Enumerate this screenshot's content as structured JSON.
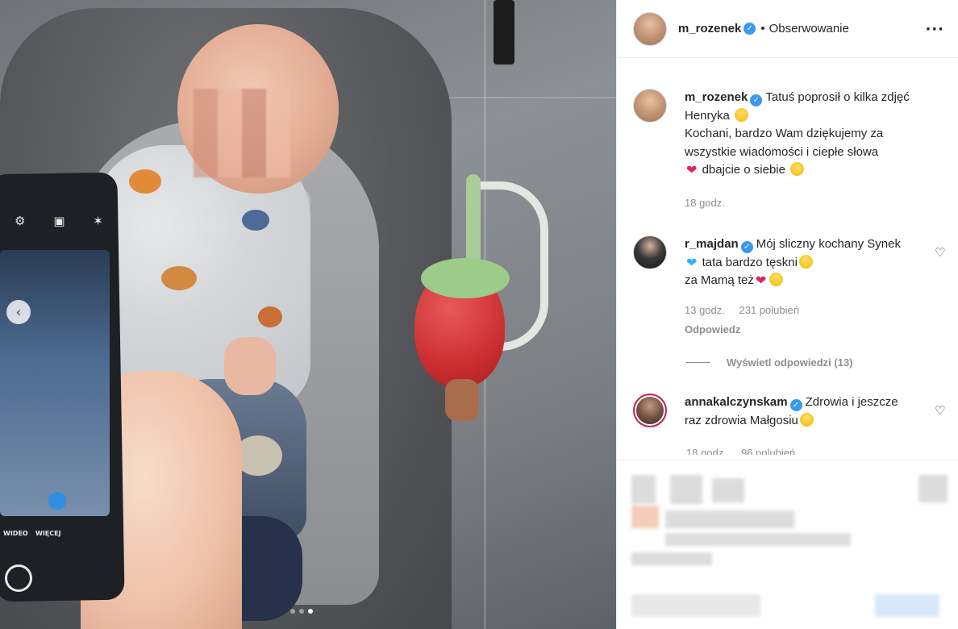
{
  "post": {
    "carousel": {
      "total": 3,
      "current": 3
    },
    "prev_icon": "chevron-left-icon"
  },
  "phone": {
    "mode_video": "WIDEO",
    "mode_more": "WIĘCEJ"
  },
  "header": {
    "username": "m_rozenek",
    "verified_icon": "verified-badge-icon",
    "separator": "•",
    "follow_label": "Obserwowanie",
    "more_icon": "more-horizontal-icon"
  },
  "caption": {
    "username": "m_rozenek",
    "line1": "Tatuś poprosił o kilka zdjęć Henryka",
    "line2": "Kochani, bardzo Wam dziękujemy za wszystkie wiadomości i ciepłe słowa",
    "line3": "dbajcie o siebie",
    "time": "18 godz."
  },
  "comments": [
    {
      "username": "r_majdan",
      "text_part1": "Mój sliczny kochany Synek",
      "text_part2": "tata bardzo tęskni",
      "text_part3": "za Mamą też",
      "time": "13 godz.",
      "likes": "231 polubień",
      "reply": "Odpowiedz"
    },
    {
      "username": "annakalczynskam",
      "text": "Zdrowia i jeszcze raz zdrowia Małgosiu",
      "time": "18 godz.",
      "likes": "96 polubień"
    }
  ],
  "view_replies": "Wyświetl odpowiedzi (13)",
  "colors": {
    "accent": "#3897f0",
    "text": "#262626",
    "muted": "#8e8e8e",
    "heart": "#e0245e"
  }
}
